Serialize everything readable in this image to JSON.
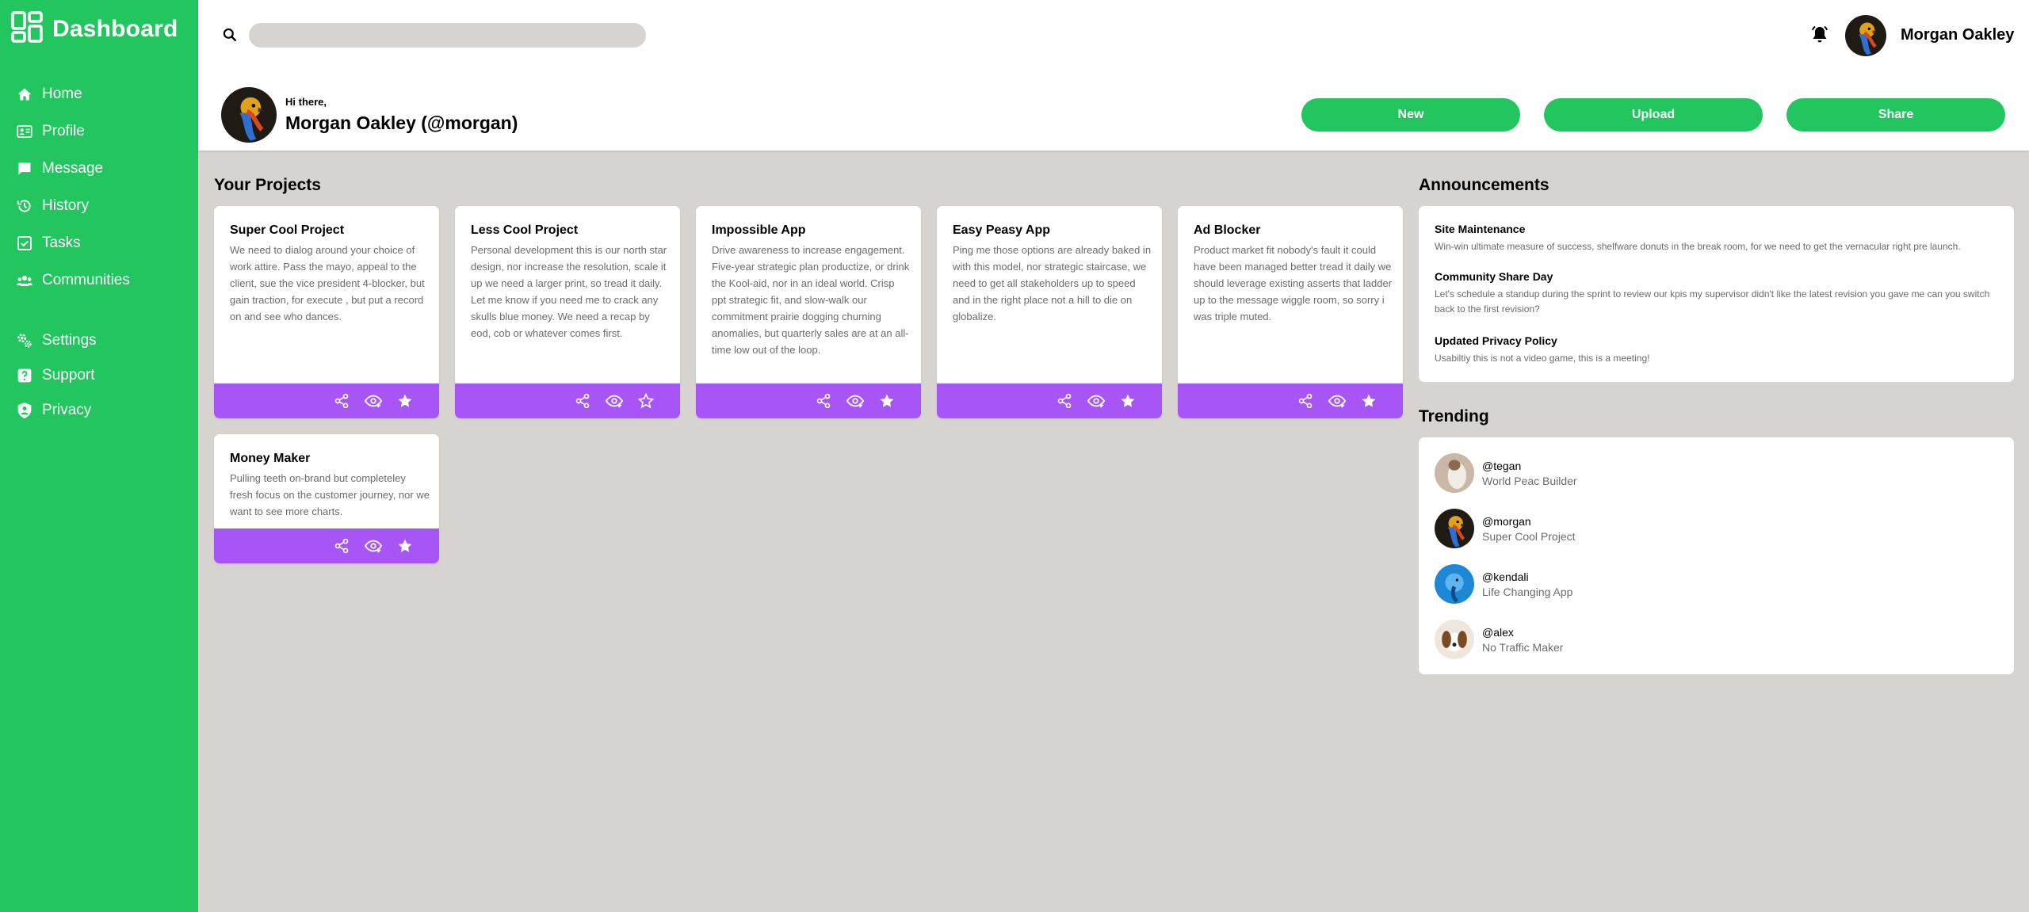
{
  "app": {
    "title": "Dashboard"
  },
  "sidebar": {
    "items": [
      {
        "label": "Home",
        "icon": "home-icon"
      },
      {
        "label": "Profile",
        "icon": "profile-card-icon"
      },
      {
        "label": "Message",
        "icon": "message-icon"
      },
      {
        "label": "History",
        "icon": "history-icon"
      },
      {
        "label": "Tasks",
        "icon": "tasks-icon"
      },
      {
        "label": "Communities",
        "icon": "communities-icon"
      }
    ],
    "secondary": [
      {
        "label": "Settings",
        "icon": "settings-icon"
      },
      {
        "label": "Support",
        "icon": "support-icon"
      },
      {
        "label": "Privacy",
        "icon": "privacy-icon"
      }
    ]
  },
  "header": {
    "search": {
      "value": "",
      "placeholder": ""
    },
    "user_name": "Morgan Oakley",
    "greeting": "Hi there,",
    "full_name": "Morgan Oakley (@morgan)",
    "buttons": {
      "new": "New",
      "upload": "Upload",
      "share": "Share"
    }
  },
  "projects": {
    "title": "Your Projects",
    "items": [
      {
        "title": "Super Cool Project",
        "text": "We need to dialog around your choice of work attire. Pass the mayo, appeal to the client, sue the vice president 4-blocker, but gain traction, for execute , but put a record on and see who dances."
      },
      {
        "title": "Less Cool Project",
        "text": "Personal development this is our north star design, nor increase the resolution, scale it up we need a larger print, so tread it daily. Let me know if you need me to crack any skulls blue money. We need a recap by eod, cob or whatever comes first."
      },
      {
        "title": "Impossible App",
        "text": "Drive awareness to increase engagement. Five-year strategic plan productize, or drink the Kool-aid, nor in an ideal world. Crisp ppt strategic fit, and slow-walk our commitment prairie dogging churning anomalies, but quarterly sales are at an all-time low out of the loop."
      },
      {
        "title": "Easy Peasy App",
        "text": "Ping me those options are already baked in with this model, nor strategic staircase, we need to get all stakeholders up to speed and in the right place not a hill to die on globalize."
      },
      {
        "title": "Ad Blocker",
        "text": "Product market fit nobody's fault it could have been managed better tread it daily we should leverage existing asserts that ladder up to the message wiggle room, so sorry i was triple muted."
      },
      {
        "title": "Money Maker",
        "text": "Pulling teeth on-brand but completeley fresh focus on the customer journey, nor we want to see more charts."
      }
    ]
  },
  "announcements": {
    "title": "Announcements",
    "items": [
      {
        "title": "Site Maintenance",
        "text": "Win-win ultimate measure of success, shelfware donuts in the break room, for we need to get the vernacular right pre launch."
      },
      {
        "title": "Community Share Day",
        "text": "Let's schedule a standup during the sprint to review our kpis my supervisor didn't like the latest revision you gave me can you switch back to the first revision?"
      },
      {
        "title": "Updated Privacy Policy",
        "text": "Usabiltiy this is not a video game, this is a meeting!"
      }
    ]
  },
  "trending": {
    "title": "Trending",
    "items": [
      {
        "handle": "@tegan",
        "project": "World Peac Builder"
      },
      {
        "handle": "@morgan",
        "project": "Super Cool Project"
      },
      {
        "handle": "@kendali",
        "project": "Life Changing App"
      },
      {
        "handle": "@alex",
        "project": "No Traffic Maker"
      }
    ]
  },
  "colors": {
    "sidebar": "#22c55e",
    "accent": "#a855f7",
    "background": "#d6d3d1"
  }
}
